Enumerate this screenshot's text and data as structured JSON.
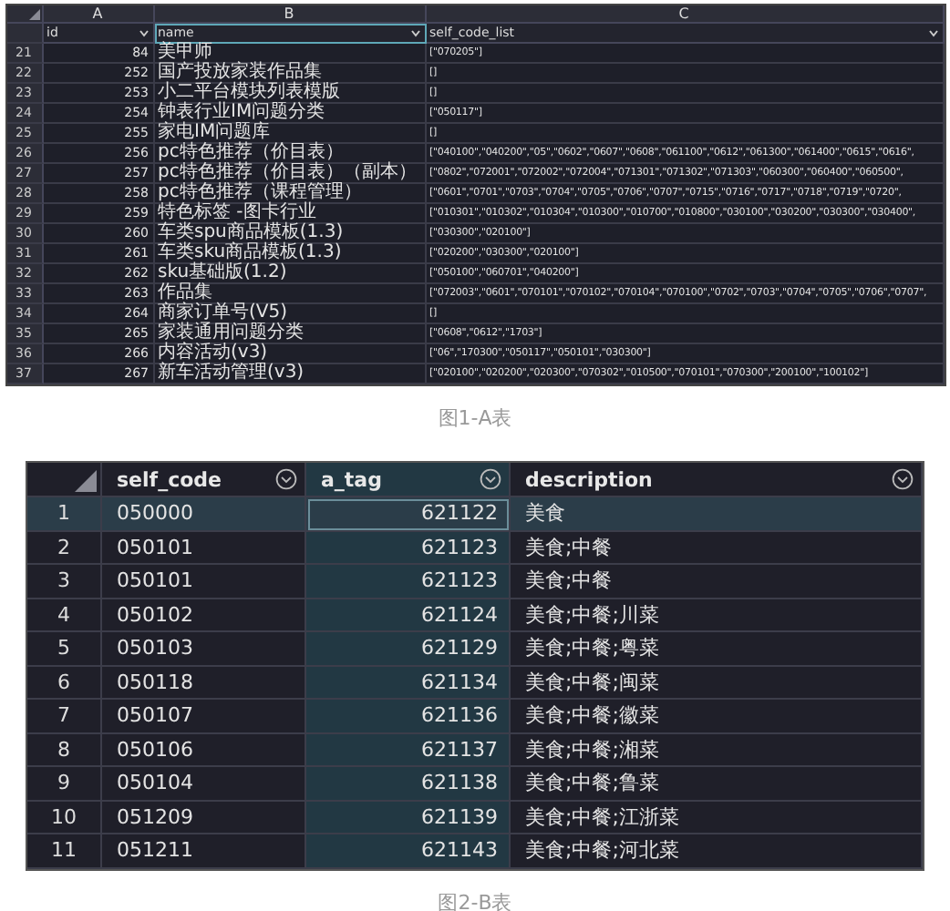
{
  "sheet_a": {
    "column_letters": [
      "A",
      "B",
      "C"
    ],
    "fields": [
      {
        "label": "id",
        "selected": false
      },
      {
        "label": "name",
        "selected": true
      },
      {
        "label": "self_code_list",
        "selected": false
      }
    ],
    "rows": [
      {
        "row": "21",
        "id": "84",
        "name": "美甲师",
        "codes": "[\"070205\"]"
      },
      {
        "row": "22",
        "id": "252",
        "name": "国产投放家装作品集",
        "codes": "[]"
      },
      {
        "row": "23",
        "id": "253",
        "name": "小二平台模块列表模版",
        "codes": "[]"
      },
      {
        "row": "24",
        "id": "254",
        "name": "钟表行业IM问题分类",
        "codes": "[\"050117\"]"
      },
      {
        "row": "25",
        "id": "255",
        "name": "家电IM问题库",
        "codes": "[]"
      },
      {
        "row": "26",
        "id": "256",
        "name": "pc特色推荐（价目表）",
        "codes": "[\"040100\",\"040200\",\"05\",\"0602\",\"0607\",\"0608\",\"061100\",\"0612\",\"061300\",\"061400\",\"0615\",\"0616\","
      },
      {
        "row": "27",
        "id": "257",
        "name": "pc特色推荐（价目表）（副本）",
        "codes": "[\"0802\",\"072001\",\"072002\",\"072004\",\"071301\",\"071302\",\"071303\",\"060300\",\"060400\",\"060500\","
      },
      {
        "row": "28",
        "id": "258",
        "name": "pc特色推荐（课程管理）",
        "codes": "[\"0601\",\"0701\",\"0703\",\"0704\",\"0705\",\"0706\",\"0707\",\"0715\",\"0716\",\"0717\",\"0718\",\"0719\",\"0720\","
      },
      {
        "row": "29",
        "id": "259",
        "name": "特色标签 -图卡行业",
        "codes": "[\"010301\",\"010302\",\"010304\",\"010300\",\"010700\",\"010800\",\"030100\",\"030200\",\"030300\",\"030400\","
      },
      {
        "row": "30",
        "id": "260",
        "name": "车类spu商品模板(1.3)",
        "codes": "[\"030300\",\"020100\"]"
      },
      {
        "row": "31",
        "id": "261",
        "name": "车类sku商品模板(1.3)",
        "codes": "[\"020200\",\"030300\",\"020100\"]"
      },
      {
        "row": "32",
        "id": "262",
        "name": "sku基础版(1.2)",
        "codes": "[\"050100\",\"060701\",\"040200\"]"
      },
      {
        "row": "33",
        "id": "263",
        "name": "作品集",
        "codes": "[\"072003\",\"0601\",\"070101\",\"070102\",\"070104\",\"070100\",\"0702\",\"0703\",\"0704\",\"0705\",\"0706\",\"0707\","
      },
      {
        "row": "34",
        "id": "264",
        "name": "商家订单号(V5)",
        "codes": "[]"
      },
      {
        "row": "35",
        "id": "265",
        "name": "家装通用问题分类",
        "codes": "[\"0608\",\"0612\",\"1703\"]"
      },
      {
        "row": "36",
        "id": "266",
        "name": "内容活动(v3)",
        "codes": "[\"06\",\"170300\",\"050117\",\"050101\",\"030300\"]"
      },
      {
        "row": "37",
        "id": "267",
        "name": "新车活动管理(v3)",
        "codes": "[\"020100\",\"020200\",\"020300\",\"070302\",\"010500\",\"070101\",\"070300\",\"200100\",\"100102\"]"
      }
    ]
  },
  "caption_a": "图1-A表",
  "sheet_b": {
    "columns": [
      {
        "label": "self_code",
        "selected": false
      },
      {
        "label": "a_tag",
        "selected": true
      },
      {
        "label": "description",
        "selected": false
      }
    ],
    "rows": [
      {
        "row": "1",
        "self_code": "050000",
        "a_tag": "621122",
        "description": "美食",
        "selected": true
      },
      {
        "row": "2",
        "self_code": "050101",
        "a_tag": "621123",
        "description": "美食;中餐",
        "selected": false
      },
      {
        "row": "3",
        "self_code": "050101",
        "a_tag": "621123",
        "description": "美食;中餐",
        "selected": false
      },
      {
        "row": "4",
        "self_code": "050102",
        "a_tag": "621124",
        "description": "美食;中餐;川菜",
        "selected": false
      },
      {
        "row": "5",
        "self_code": "050103",
        "a_tag": "621129",
        "description": "美食;中餐;粤菜",
        "selected": false
      },
      {
        "row": "6",
        "self_code": "050118",
        "a_tag": "621134",
        "description": "美食;中餐;闽菜",
        "selected": false
      },
      {
        "row": "7",
        "self_code": "050107",
        "a_tag": "621136",
        "description": "美食;中餐;徽菜",
        "selected": false
      },
      {
        "row": "8",
        "self_code": "050106",
        "a_tag": "621137",
        "description": "美食;中餐;湘菜",
        "selected": false
      },
      {
        "row": "9",
        "self_code": "050104",
        "a_tag": "621138",
        "description": "美食;中餐;鲁菜",
        "selected": false
      },
      {
        "row": "10",
        "self_code": "051209",
        "a_tag": "621139",
        "description": "美食;中餐;江浙菜",
        "selected": false
      },
      {
        "row": "11",
        "self_code": "051211",
        "a_tag": "621143",
        "description": "美食;中餐;河北菜",
        "selected": false
      }
    ]
  },
  "caption_b": "图2-B表"
}
